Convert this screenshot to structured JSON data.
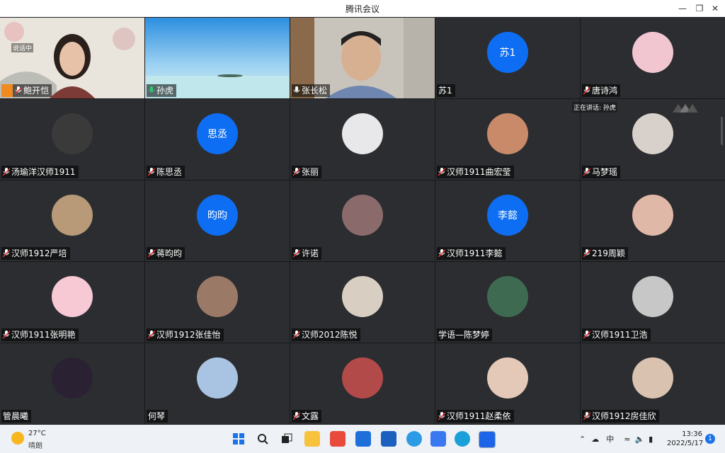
{
  "window": {
    "title": "腾讯会议"
  },
  "meeting": {
    "speaking_label": "正在讲话: 孙虎",
    "participants": [
      {
        "name": "鲍开恺",
        "avatar_type": "video",
        "extra_label": "说话中"
      },
      {
        "name": "孙虎",
        "avatar_type": "video",
        "mic": "active"
      },
      {
        "name": "张长松",
        "avatar_type": "video"
      },
      {
        "name": "苏1",
        "avatar_type": "text",
        "avatar_text": "苏1"
      },
      {
        "name": "唐诗鸿",
        "avatar_type": "photo"
      },
      {
        "name": "汤瑜洋汉师1911",
        "avatar_type": "photo"
      },
      {
        "name": "陈思丞",
        "avatar_type": "text",
        "avatar_text": "思丞"
      },
      {
        "name": "张丽",
        "avatar_type": "photo"
      },
      {
        "name": "汉师1911曲宏莹",
        "avatar_type": "photo"
      },
      {
        "name": "马梦瑶",
        "avatar_type": "photo"
      },
      {
        "name": "汉师1912严培",
        "avatar_type": "photo"
      },
      {
        "name": "蒋昀昀",
        "avatar_type": "text",
        "avatar_text": "昀昀"
      },
      {
        "name": "许诺",
        "avatar_type": "photo"
      },
      {
        "name": "汉师1911李懿",
        "avatar_type": "text",
        "avatar_text": "李懿"
      },
      {
        "name": "219周颖",
        "avatar_type": "photo"
      },
      {
        "name": "汉师1911张明艳",
        "avatar_type": "photo"
      },
      {
        "name": "汉师1912张佳怡",
        "avatar_type": "photo"
      },
      {
        "name": "汉师2012陈悦",
        "avatar_type": "photo"
      },
      {
        "name": "学语—陈梦婷",
        "avatar_type": "photo"
      },
      {
        "name": "汉师1911卫浩",
        "avatar_type": "photo"
      },
      {
        "name": "管晨曦",
        "avatar_type": "photo"
      },
      {
        "name": "何琴",
        "avatar_type": "photo"
      },
      {
        "name": "文露",
        "avatar_type": "photo"
      },
      {
        "name": "汉师1911赵柔依",
        "avatar_type": "photo"
      },
      {
        "name": "汉师1912房佳欣",
        "avatar_type": "photo"
      }
    ]
  },
  "taskbar": {
    "weather": {
      "temp": "27°C",
      "condition": "晴朗"
    },
    "ime": "中",
    "clock": {
      "time": "13:36",
      "date": "2022/5/17"
    },
    "notification_count": "1",
    "apps": [
      "windows-start",
      "search",
      "task-view",
      "file-explorer",
      "store",
      "mail",
      "sticky",
      "edge",
      "wps",
      "edge-beta",
      "tencent-meeting"
    ]
  }
}
